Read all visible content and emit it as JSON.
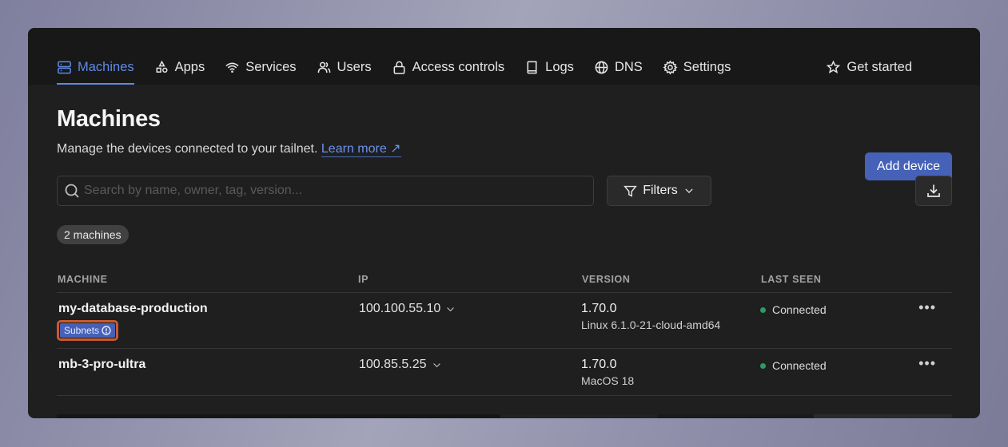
{
  "nav": {
    "items": [
      {
        "label": "Machines",
        "icon": "machines-icon",
        "active": true
      },
      {
        "label": "Apps",
        "icon": "apps-icon",
        "active": false
      },
      {
        "label": "Services",
        "icon": "wifi-icon",
        "active": false
      },
      {
        "label": "Users",
        "icon": "users-icon",
        "active": false
      },
      {
        "label": "Access controls",
        "icon": "lock-icon",
        "active": false
      },
      {
        "label": "Logs",
        "icon": "book-icon",
        "active": false
      },
      {
        "label": "DNS",
        "icon": "globe-icon",
        "active": false
      },
      {
        "label": "Settings",
        "icon": "gear-icon",
        "active": false
      }
    ],
    "get_started": {
      "label": "Get started",
      "icon": "star-icon"
    }
  },
  "header": {
    "title": "Machines",
    "subtitle": "Manage the devices connected to your tailnet.",
    "learn_more": "Learn more ↗",
    "add_device": "Add device"
  },
  "toolbar": {
    "search_placeholder": "Search by name, owner, tag, version...",
    "search_value": "",
    "filters_label": "Filters"
  },
  "count_badge": "2 machines",
  "table": {
    "columns": [
      "MACHINE",
      "IP",
      "VERSION",
      "LAST SEEN"
    ],
    "rows": [
      {
        "name": "my-database-production",
        "tag": "Subnets",
        "ip": "100.100.55.10",
        "version": "1.70.0",
        "os": "Linux 6.1.0-21-cloud-amd64",
        "last_seen": "Connected"
      },
      {
        "name": "mb-3-pro-ultra",
        "tag": null,
        "ip": "100.85.5.25",
        "version": "1.70.0",
        "os": "MacOS 18",
        "last_seen": "Connected"
      }
    ]
  },
  "colors": {
    "accent": "#5f8ae6",
    "button": "#4561b8",
    "connected": "#2d9a68",
    "highlight": "#c85a32"
  }
}
